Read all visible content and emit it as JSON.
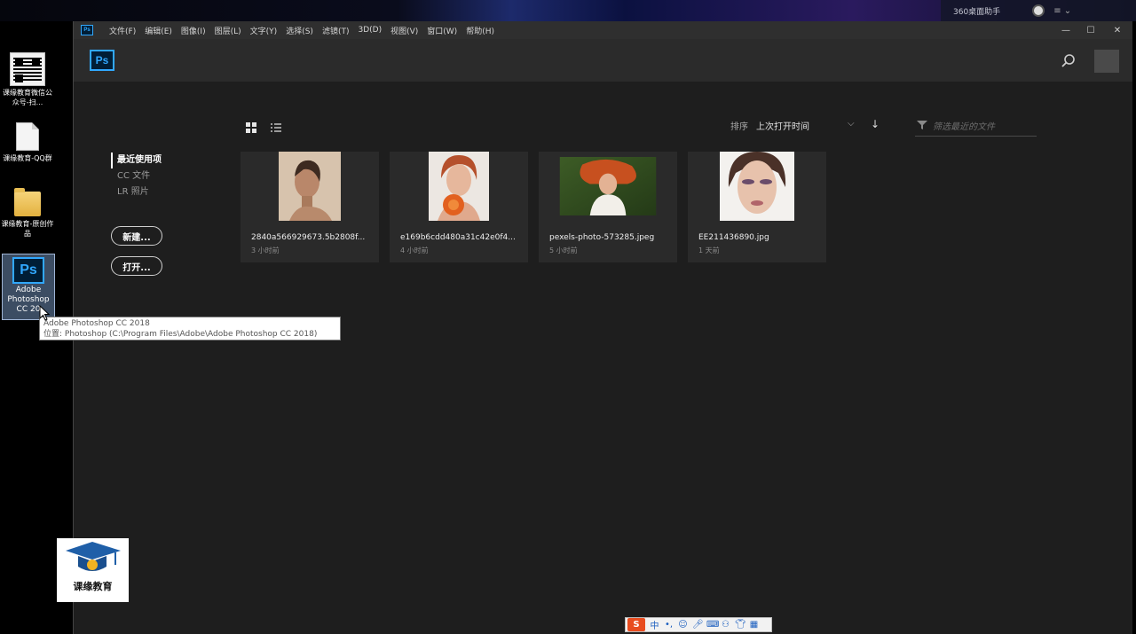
{
  "desktop": {
    "assistant_label": "360桌面助手",
    "icons": [
      {
        "label": "课缘教育微信公众号-扫..."
      },
      {
        "label": "课缘教育-QQ群"
      },
      {
        "label": "课缘教育-原创作品"
      },
      {
        "label": "Adobe Photoshop CC 2018",
        "short": "Adobe Photoshop CC 20"
      }
    ],
    "tooltip": {
      "line1": "Adobe Photoshop CC 2018",
      "line2": "位置: Photoshop (C:\\Program Files\\Adobe\\Adobe Photoshop CC 2018)"
    },
    "brand_logo_text": "课缘教育"
  },
  "app": {
    "title_logo": "Ps",
    "menu": [
      "文件(F)",
      "编辑(E)",
      "图像(I)",
      "图层(L)",
      "文字(Y)",
      "选择(S)",
      "滤镜(T)",
      "3D(D)",
      "视图(V)",
      "窗口(W)",
      "帮助(H)"
    ],
    "window_controls": [
      "—",
      "☐",
      "✕"
    ],
    "header_logo": "Ps"
  },
  "home": {
    "nav": [
      "最近使用项",
      "CC 文件",
      "LR 照片"
    ],
    "new_button": "新建...",
    "open_button": "打开...",
    "sort_label": "排序",
    "sort_value": "上次打开时间",
    "filter_placeholder": "筛选最近的文件",
    "files": [
      {
        "name": "2840a566929673.5b2808f...",
        "time": "3 小时前"
      },
      {
        "name": "e169b6cdd480a31c42e0f4...",
        "time": "4 小时前"
      },
      {
        "name": "pexels-photo-573285.jpeg",
        "time": "5 小时前"
      },
      {
        "name": "EE211436890.jpg",
        "time": "1 天前"
      }
    ]
  },
  "ime_bar": {
    "logo": "S",
    "mode": "中"
  }
}
